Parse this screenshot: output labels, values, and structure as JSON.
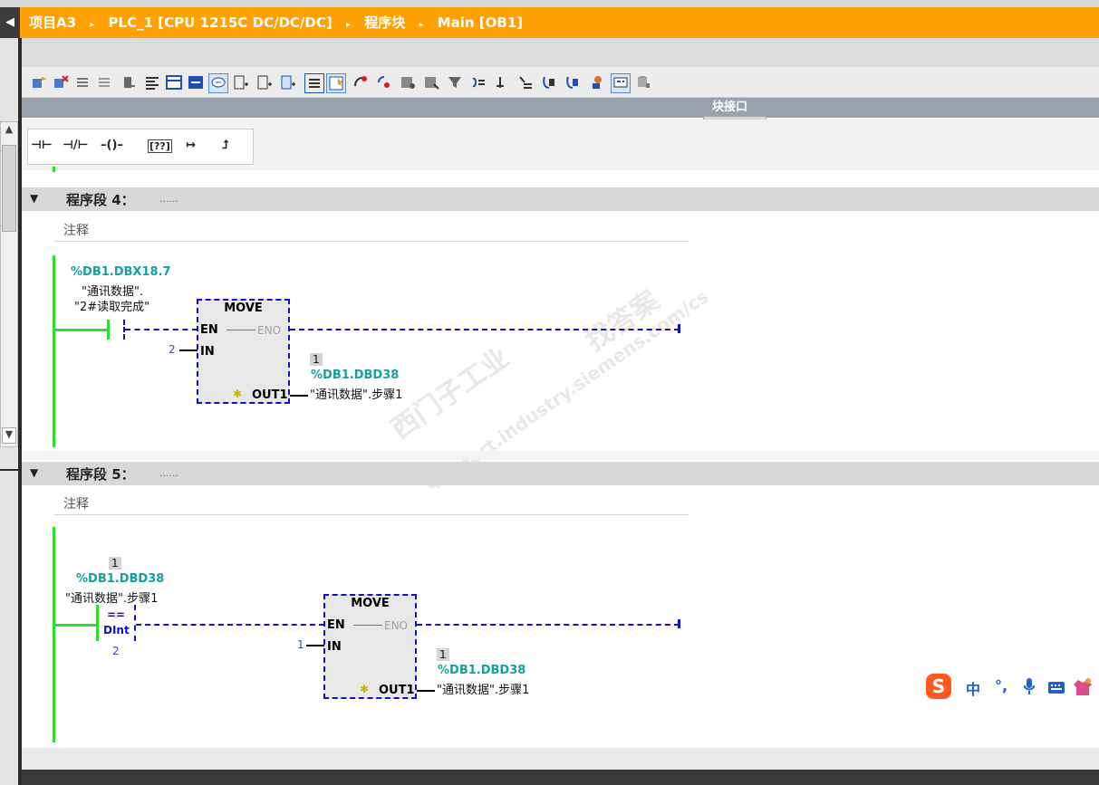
{
  "breadcrumb": {
    "back_icon": "◀",
    "items": [
      "项目A3",
      "PLC_1 [CPU 1215C DC/DC/DC]",
      "程序块",
      "Main [OB1]"
    ],
    "separator": "▸"
  },
  "interface_bar": {
    "label": "块接口"
  },
  "ladder_toolbar": {
    "items": [
      "⊣⊢",
      "⊣/⊢",
      "–()–",
      "[??]",
      "↦",
      "⮥"
    ]
  },
  "colors": {
    "accent": "#fea006",
    "power_rail": "#2ee02e",
    "wire_dash": "#1010d0",
    "address": "#14a0a0"
  },
  "network4": {
    "title": "程序段 4：",
    "dots": "......",
    "comment": "注释",
    "contact_address": "%DB1.DBX18.7",
    "contact_symbol_1": "\"通讯数据\".",
    "contact_symbol_2": "\"2#读取完成\"",
    "block": {
      "name": "MOVE",
      "en": "EN",
      "eno": "ENO",
      "in_pin": "IN",
      "in_value": "2",
      "out_pin": "OUT1",
      "out_monitor": "1",
      "out_address": "%DB1.DBD38",
      "out_symbol": "\"通讯数据\".步骤1"
    }
  },
  "network5": {
    "title": "程序段 5：",
    "dots": "......",
    "comment": "注释",
    "compare_monitor": "1",
    "compare_address": "%DB1.DBD38",
    "compare_symbol": "\"通讯数据\".步骤1",
    "compare_op": "==",
    "compare_type": "DInt",
    "compare_value": "2",
    "block": {
      "name": "MOVE",
      "en": "EN",
      "eno": "ENO",
      "in_pin": "IN",
      "in_value": "1",
      "out_pin": "OUT1",
      "out_monitor": "1",
      "out_address": "%DB1.DBD38",
      "out_symbol": "\"通讯数据\".步骤1"
    }
  },
  "watermark": {
    "line1": "西门子工业",
    "line2": "support.industry.siemens.com/cs",
    "line3": "找答案"
  },
  "ime": {
    "logo": "S",
    "lang": "中",
    "punct": "°,",
    "mic_icon": "microphone-icon",
    "keyboard_icon": "keyboard-icon",
    "skin_icon": "shirt-icon"
  }
}
